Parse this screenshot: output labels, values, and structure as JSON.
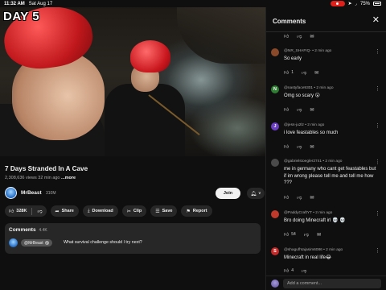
{
  "status_bar": {
    "time": "11:32 AM",
    "date": "Sat Aug 17",
    "battery": "75%"
  },
  "video": {
    "overlay_text": "DAY 5"
  },
  "meta": {
    "title": "7 Days Stranded In A Cave",
    "views_time": "2,308,636 views  32 min ago",
    "more": "...more"
  },
  "channel": {
    "name": "MrBeast",
    "subscribers": "310M",
    "join_label": "Join",
    "bell_icon": "bell-icon"
  },
  "actions": {
    "likes": "328K",
    "share": "Share",
    "download": "Download",
    "clip": "Clip",
    "save": "Save",
    "report": "Report"
  },
  "comments_card": {
    "heading": "Comments",
    "count": "4.4K",
    "pinned_author": "@MrBeast",
    "pinned_text": "What survival challenge should I try next?"
  },
  "panel": {
    "title": "Comments",
    "add_placeholder": "Add a comment...",
    "comments": [
      {
        "handle": "@NR_SHAFIQ- • 2 min ago",
        "text": "So early",
        "likes": "1",
        "avatar_letter": "",
        "avatar_color": "#8a4a2a"
      },
      {
        "handle": "@nastyface9301 • 2 min ago",
        "text": "Omg so scary 😮",
        "likes": "",
        "avatar_letter": "N",
        "avatar_color": "#2e7d32"
      },
      {
        "handle": "@jess-ju2lz • 2 min ago",
        "text": "i love feastables so much",
        "likes": "",
        "avatar_letter": "J",
        "avatar_color": "#6a3fbf"
      },
      {
        "handle": "@gabrielstoegler2741 • 2 min ago",
        "text": "me in germany who cant get feastables but if im wrong please tell me and tell me how ???",
        "likes": "",
        "avatar_letter": "",
        "avatar_color": "#4a4a4a"
      },
      {
        "handle": "@PaddyCraftYT • 2 min ago",
        "text": "Bro doing Minecraft irl 💀 💀",
        "likes": "54",
        "avatar_letter": "",
        "avatar_color": "#c0392b"
      },
      {
        "handle": "@shagufhtajasim6086 • 2 min ago",
        "text": "Minecraft in real life😂",
        "likes": "4",
        "avatar_letter": "S",
        "avatar_color": "#c62828"
      }
    ]
  }
}
